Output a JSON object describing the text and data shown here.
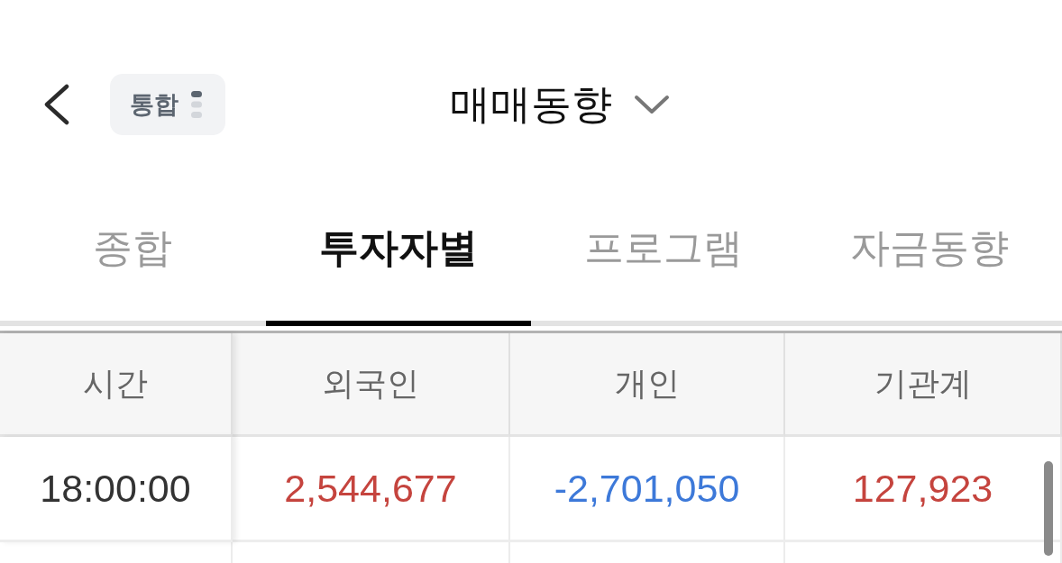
{
  "header": {
    "badge": {
      "label": "통합"
    },
    "title": "매매동향"
  },
  "tabs": [
    {
      "label": "종합",
      "selected": false
    },
    {
      "label": "투자자별",
      "selected": true
    },
    {
      "label": "프로그램",
      "selected": false
    },
    {
      "label": "자금동향",
      "selected": false
    }
  ],
  "table": {
    "columns": [
      "시간",
      "외국인",
      "개인",
      "기관계"
    ],
    "rows": [
      {
        "cells": [
          {
            "text": "18:00:00"
          },
          {
            "text": "2,544,677",
            "color": "#c5443e"
          },
          {
            "text": "-2,701,050",
            "color": "#3d79d9"
          },
          {
            "text": "127,923",
            "color": "#c5443e"
          }
        ]
      }
    ]
  }
}
